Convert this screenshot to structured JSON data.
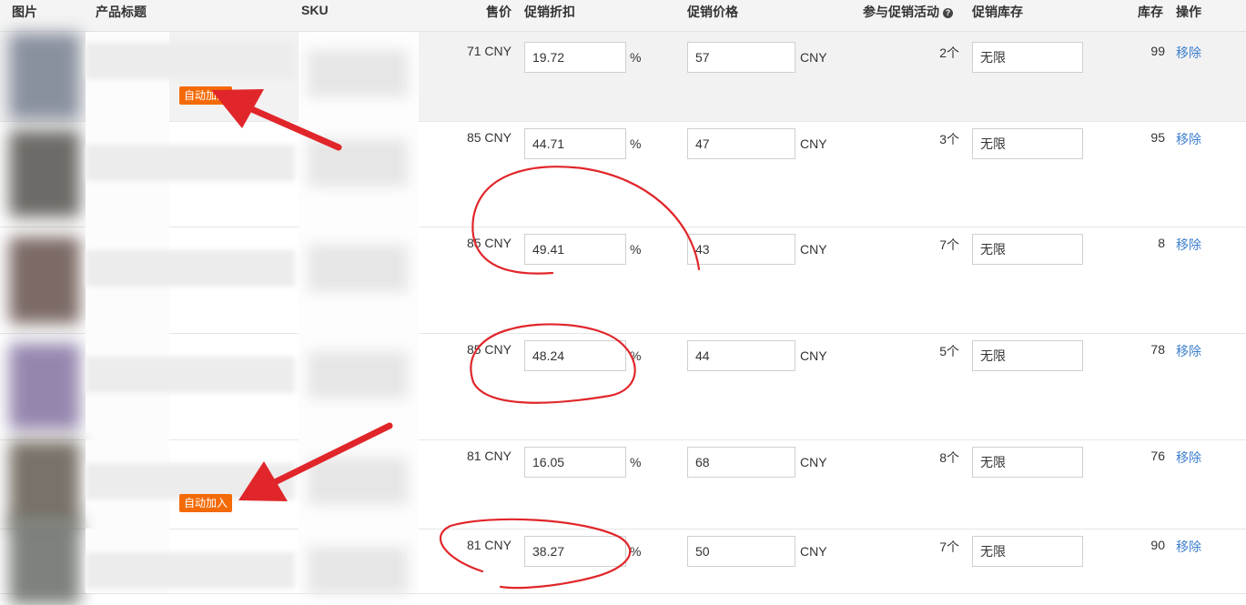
{
  "columns": {
    "image": "图片",
    "title": "产品标题",
    "sku": "SKU",
    "price": "售价",
    "discount": "促销折扣",
    "promo_price": "促销价格",
    "activities": "参与促销活动",
    "promo_stock": "促销库存",
    "stock": "库存",
    "action": "操作"
  },
  "help_icon_glyph": "?",
  "unit_percent": "%",
  "unit_currency": "CNY",
  "badge_label": "自动加入",
  "remove_label": "移除",
  "rows": [
    {
      "price": "71 CNY",
      "discount": "19.72",
      "promo_price": "57",
      "activities": "2个",
      "promo_stock": "无限",
      "stock": "99",
      "auto_join": true,
      "thumb_color": "#7e8797"
    },
    {
      "price": "85 CNY",
      "discount": "44.71",
      "promo_price": "47",
      "activities": "3个",
      "promo_stock": "无限",
      "stock": "95",
      "auto_join": false,
      "thumb_color": "#5e5b57"
    },
    {
      "price": "85 CNY",
      "discount": "49.41",
      "promo_price": "43",
      "activities": "7个",
      "promo_stock": "无限",
      "stock": "8",
      "auto_join": false,
      "thumb_color": "#6e5a55"
    },
    {
      "price": "85 CNY",
      "discount": "48.24",
      "promo_price": "44",
      "activities": "5个",
      "promo_stock": "无限",
      "stock": "78",
      "auto_join": false,
      "thumb_color": "#8a7aa6"
    },
    {
      "price": "81 CNY",
      "discount": "16.05",
      "promo_price": "68",
      "activities": "8个",
      "promo_stock": "无限",
      "stock": "76",
      "auto_join": true,
      "thumb_color": "#6b6359"
    },
    {
      "price": "81 CNY",
      "discount": "38.27",
      "promo_price": "50",
      "activities": "7个",
      "promo_stock": "无限",
      "stock": "90",
      "auto_join": false,
      "thumb_color": "#707570"
    }
  ],
  "colors": {
    "accent_link": "#3d7fce",
    "badge_orange": "#f46a07",
    "annotation_red": "#e0262a"
  }
}
